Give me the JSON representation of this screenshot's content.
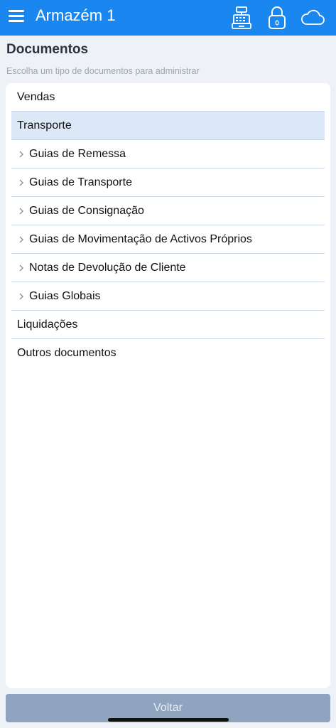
{
  "header": {
    "title": "Armazém 1",
    "lock_count": "0",
    "background_color": "#1a86f0"
  },
  "page": {
    "title": "Documentos",
    "subtitle": "Escolha um tipo de documentos para administrar"
  },
  "document_types": [
    {
      "label": "Vendas",
      "level": "top",
      "selected": false
    },
    {
      "label": "Transporte",
      "level": "top",
      "selected": true
    },
    {
      "label": "Guias de Remessa",
      "level": "sub",
      "icon": "chevron-right-icon"
    },
    {
      "label": "Guias de Transporte",
      "level": "sub",
      "icon": "chevron-right-icon"
    },
    {
      "label": "Guias de Consignação",
      "level": "sub",
      "icon": "chevron-right-icon"
    },
    {
      "label": "Guias de Movimentação de Activos Próprios",
      "level": "sub",
      "icon": "chevron-right-icon"
    },
    {
      "label": "Notas de Devolução de Cliente",
      "level": "sub",
      "icon": "chevron-right-icon"
    },
    {
      "label": "Guias Globais",
      "level": "sub",
      "icon": "chevron-right-icon"
    },
    {
      "label": "Liquidações",
      "level": "top",
      "selected": false
    },
    {
      "label": "Outros documentos",
      "level": "top",
      "selected": false
    }
  ],
  "footer": {
    "back_label": "Voltar"
  },
  "icons": [
    "menu-icon",
    "cash-register-icon",
    "lock-icon",
    "cloud-icon"
  ]
}
